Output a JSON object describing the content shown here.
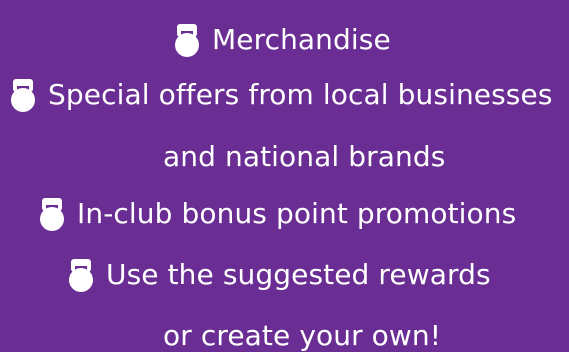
{
  "lines": [
    {
      "text": "Merchandise",
      "icon": "kettlebell-icon"
    },
    {
      "text": "Special offers from local businesses",
      "icon": "kettlebell-icon"
    },
    {
      "text": "and national brands"
    },
    {
      "text": "In-club bonus point promotions",
      "icon": "kettlebell-icon"
    },
    {
      "text": "Use the suggested rewards",
      "icon": "kettlebell-icon"
    },
    {
      "text": "or create your own!"
    }
  ],
  "colors": {
    "background": "#6a2d93",
    "text": "#ffffff",
    "icon": "#ffffff"
  }
}
